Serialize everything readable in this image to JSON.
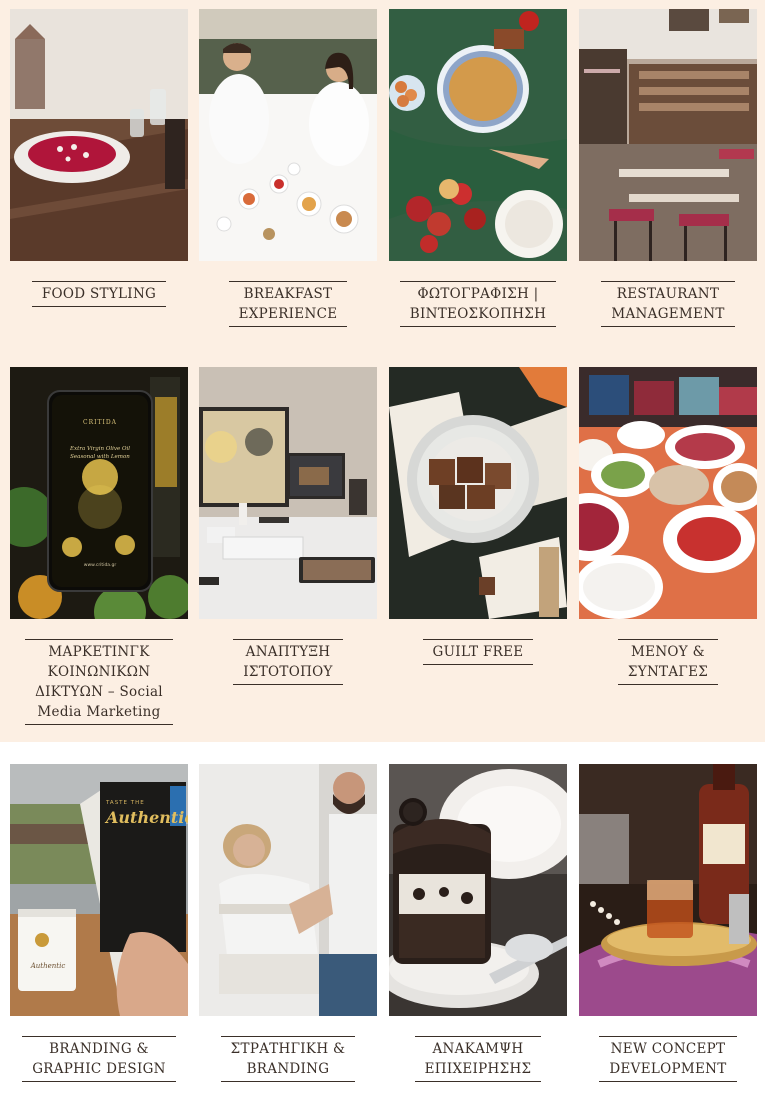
{
  "services": [
    {
      "title": "FOOD STYLING",
      "image": "beet-salad-bowl-photo"
    },
    {
      "title": "BREAKFAST\nEXPERIENCE",
      "image": "couple-breakfast-in-bed-photo"
    },
    {
      "title": "ΦΩΤΟΓΡΑΦΙΣΗ |\nΒΙΝΤΕΟΣΚΟΠΗΣΗ",
      "image": "food-table-apples-photo"
    },
    {
      "title": "RESTAURANT\nMANAGEMENT",
      "image": "restaurant-interior-photo"
    },
    {
      "title": "ΜΑΡΚΕΤΙΝΓΚ\nΚΟΙΝΩΝΙΚΩΝ\nΔΙΚΤΥΩΝ – Social\nMedia Marketing",
      "image": "phone-olive-oil-ad-photo"
    },
    {
      "title": "ΑΝΑΠΤΥΞΗ\nΙΣΤΟΤΟΠΟΥ",
      "image": "desk-computer-photo"
    },
    {
      "title": "GUILT FREE",
      "image": "baklava-plate-photo"
    },
    {
      "title": "ΜΕΝΟΥ &\nΣΥΝΤΑΓΕΣ",
      "image": "greek-dishes-table-photo"
    },
    {
      "title": "BRANDING &\nGRAPHIC DESIGN",
      "image": "coffee-cup-menu-photo"
    },
    {
      "title": "ΣΤΡΑΤΗΓΙΚΗ &\nBRANDING",
      "image": "couple-planning-photo"
    },
    {
      "title": "ΑΝΑΚΑΜΨΗ\nΕΠΙΧΕΙΡΗΣΗΣ",
      "image": "chocolate-cake-photo"
    },
    {
      "title": "NEW CONCEPT\nDEVELOPMENT",
      "image": "disaronno-cocktail-photo"
    }
  ],
  "phone_ad": {
    "brand": "CRITIDA",
    "tagline": "Extra Virgin Olive Oil\nSeasonal with Lemon",
    "footer": "www.critida.gr"
  },
  "menu_cover": {
    "kicker": "TASTE THE",
    "headline": "Authentic"
  },
  "cup_label": "Authentic"
}
